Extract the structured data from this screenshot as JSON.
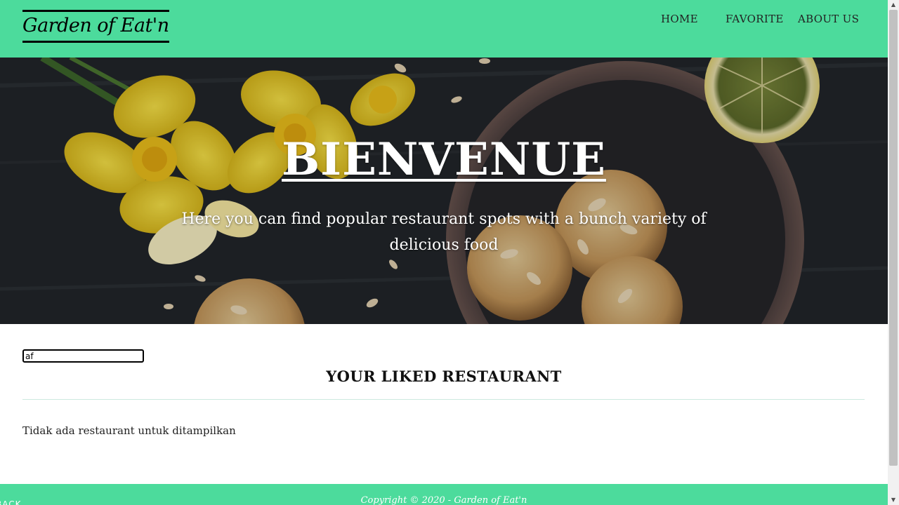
{
  "header": {
    "brand": "Garden of Eat'n",
    "nav": {
      "home": "HOME",
      "favorite": "FAVORITE",
      "about": "ABOUT US"
    },
    "background_color": "#4cdb9c"
  },
  "hero": {
    "title": "BIENVENUE",
    "subtitle": "Here you can find popular restaurant spots with a bunch variety of delicious food"
  },
  "main": {
    "search_value": "af",
    "section_title": "YOUR LIKED RESTAURANT",
    "empty_message": "Tidak ada restaurant untuk ditampilkan"
  },
  "footer": {
    "back_label": "BACK",
    "copyright": "Copyright © 2020 - Garden of Eat'n",
    "background_color": "#4cdb9c"
  },
  "scrollbar": {
    "up_icon": "triangle-up-icon",
    "down_icon": "triangle-down-icon"
  }
}
